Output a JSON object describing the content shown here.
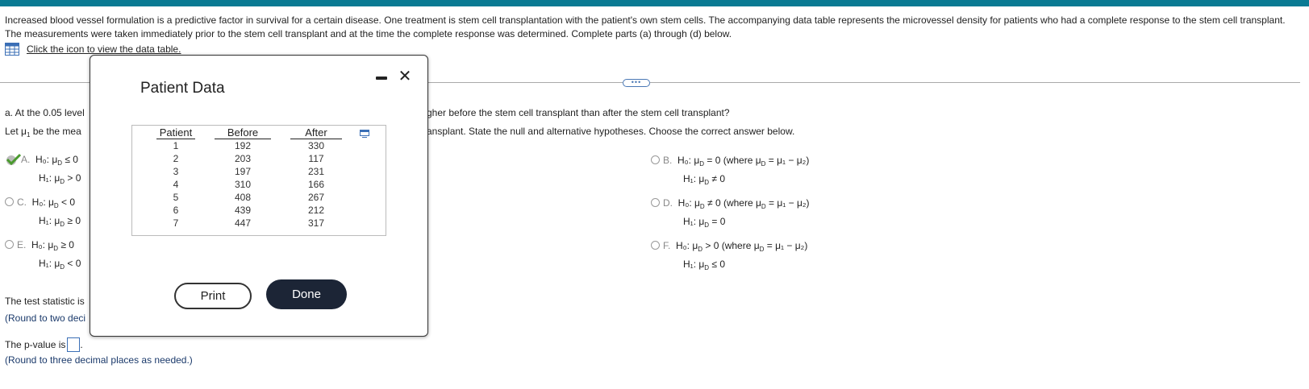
{
  "intro_text": "Increased blood vessel formulation is a predictive factor in survival for a certain disease. One treatment is stem cell transplantation with the patient's own stem cells. The accompanying data table represents the microvessel density for patients who had a complete response to the stem cell transplant. The measurements were taken immediately prior to the stem cell transplant and at the time the complete response was determined. Complete parts (a) through (d) below.",
  "data_table_link": "Click the icon to view the data table.",
  "part_a": {
    "question_left": "a. At the 0.05 level",
    "question_right": "gher before the stem cell transplant than after the stem cell transplant?",
    "let_left": "Let μ",
    "let_left_sub": "1",
    "let_left_end": " be the mea",
    "let_right": "ansplant. State the null and alternative hypotheses. Choose the correct answer below."
  },
  "options": {
    "A": {
      "letter": "A.",
      "h0": "H₀: μ",
      "h0_rel": " ≤ 0",
      "h1": "H₁: μ",
      "h1_rel": " > 0",
      "selected": true
    },
    "B": {
      "letter": "B.",
      "h0": "H₀: μ",
      "h0_rel": " = 0 (where μ",
      "h0_tail": " = μ₁ − μ₂)",
      "h1": "H₁: μ",
      "h1_rel": " ≠ 0"
    },
    "C": {
      "letter": "C.",
      "h0": "H₀: μ",
      "h0_rel": " < 0",
      "h1": "H₁: μ",
      "h1_rel": " ≥ 0"
    },
    "D": {
      "letter": "D.",
      "h0": "H₀: μ",
      "h0_rel": " ≠ 0 (where μ",
      "h0_tail": " = μ₁ − μ₂)",
      "h1": "H₁: μ",
      "h1_rel": " = 0"
    },
    "E": {
      "letter": "E.",
      "h0": "H₀: μ",
      "h0_rel": " ≥ 0",
      "h1": "H₁: μ",
      "h1_rel": " < 0"
    },
    "F": {
      "letter": "F.",
      "h0": "H₀: μ",
      "h0_rel": " > 0 (where μ",
      "h0_tail": " = μ₁ − μ₂)",
      "h1": "H₁: μ",
      "h1_rel": " ≤ 0"
    }
  },
  "sub_D": "D",
  "test_statistic": {
    "label": "The test statistic is",
    "hint": "(Round to two deci"
  },
  "p_value": {
    "label": "The p-value is",
    "hint": "(Round to three decimal places as needed.)"
  },
  "dots_label": "•••",
  "modal": {
    "title": "Patient Data",
    "close": "✕",
    "print": "Print",
    "done": "Done",
    "table": {
      "headers": [
        "Patient",
        "Before",
        "After"
      ],
      "patient": [
        "1",
        "2",
        "3",
        "4",
        "5",
        "6",
        "7"
      ],
      "before": [
        "192",
        "203",
        "197",
        "310",
        "408",
        "439",
        "447"
      ],
      "after": [
        "330",
        "117",
        "231",
        "166",
        "267",
        "212",
        "317"
      ]
    }
  }
}
